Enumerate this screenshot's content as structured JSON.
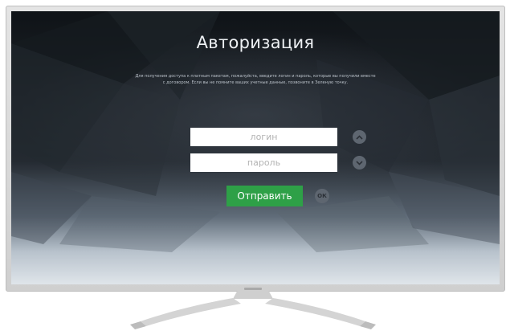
{
  "screen": {
    "title": "Авторизация",
    "info_text": "Для получения доступа к платным пакетам, пожалуйста, введите логин и пароль, которые вы получили вместе с договором. Если вы не помните ваших учетные данные, позвоните в Зеленую точку.",
    "login_placeholder": "логин",
    "password_placeholder": "пароль",
    "submit_label": "Отправить",
    "ok_label": "ОК"
  },
  "icons": {
    "up": "chevron-up-icon",
    "down": "chevron-down-icon"
  },
  "colors": {
    "accent": "#2ea047",
    "background_dark": "#1c2127",
    "field": "#ffffff",
    "round_button": "#5e6670",
    "bezel": "#d9d9d9"
  }
}
